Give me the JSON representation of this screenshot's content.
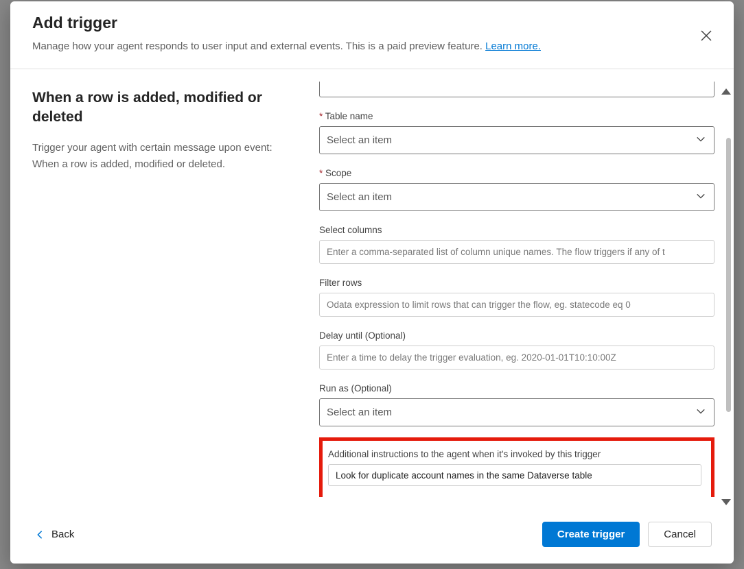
{
  "header": {
    "title": "Add trigger",
    "subtitle": "Manage how your agent responds to user input and external events. This is a paid preview feature. ",
    "learn_more": "Learn more."
  },
  "left": {
    "title": "When a row is added, modified or deleted",
    "description": "Trigger your agent with certain message upon event: When a row is added, modified or deleted."
  },
  "form": {
    "table_name": {
      "label": "Table name",
      "value": "Select an item"
    },
    "scope": {
      "label": "Scope",
      "value": "Select an item"
    },
    "select_columns": {
      "label": "Select columns",
      "placeholder": "Enter a comma-separated list of column unique names. The flow triggers if any of t"
    },
    "filter_rows": {
      "label": "Filter rows",
      "placeholder": "Odata expression to limit rows that can trigger the flow, eg. statecode eq 0"
    },
    "delay_until": {
      "label": "Delay until (Optional)",
      "placeholder": "Enter a time to delay the trigger evaluation, eg. 2020-01-01T10:10:00Z"
    },
    "run_as": {
      "label": "Run as (Optional)",
      "value": "Select an item"
    },
    "additional_instructions": {
      "label": "Additional instructions to the agent when it's invoked by this trigger",
      "value": "Look for duplicate account names in the same Dataverse table"
    }
  },
  "footer": {
    "back": "Back",
    "create": "Create trigger",
    "cancel": "Cancel"
  }
}
